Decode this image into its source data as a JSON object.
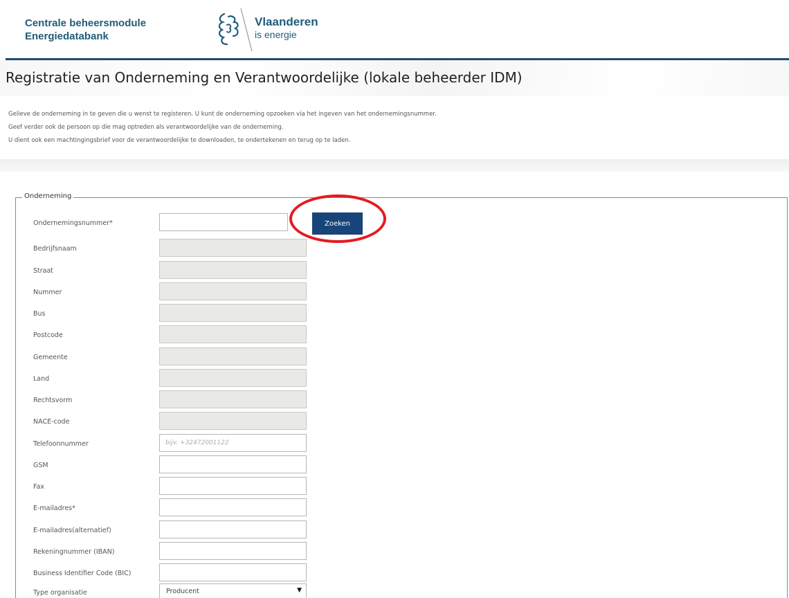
{
  "header": {
    "brand_line1": "Centrale beheersmodule",
    "brand_line2": "Energiedatabank",
    "logo_line1": "Vlaanderen",
    "logo_line2": "is energie",
    "accent_color": "#1f4b6e",
    "logo_icon": "flemish-lion-icon"
  },
  "page": {
    "title": "Registratie van Onderneming en Verantwoordelijke (lokale beheerder IDM)",
    "intro": [
      "Gelieve de onderneming in te geven die u wenst te registeren. U kunt de onderneming opzoeken via het ingeven van het ondernemingsnummer.",
      "Geef verder ook de persoon op die mag optreden als verantwoordelijke van de onderneming.",
      "U dient ook een machtingingsbrief voor de verantwoordelijke te downloaden, te ondertekenen en terug op te laden."
    ]
  },
  "form": {
    "legend": "Onderneming",
    "search_button": "Zoeken",
    "search_button_color": "#17457a",
    "annotation_color": "#e31b23",
    "fields": {
      "ondernemingsnummer": {
        "label": "Ondernemingsnummer*",
        "value": ""
      },
      "bedrijfsnaam": {
        "label": "Bedrijfsnaam",
        "value": ""
      },
      "straat": {
        "label": "Straat",
        "value": ""
      },
      "nummer": {
        "label": "Nummer",
        "value": ""
      },
      "bus": {
        "label": "Bus",
        "value": ""
      },
      "postcode": {
        "label": "Postcode",
        "value": ""
      },
      "gemeente": {
        "label": "Gemeente",
        "value": ""
      },
      "land": {
        "label": "Land",
        "value": ""
      },
      "rechtsvorm": {
        "label": "Rechtsvorm",
        "value": ""
      },
      "nace_code": {
        "label": "NACE-code",
        "value": ""
      },
      "telefoonnummer": {
        "label": "Telefoonnummer",
        "value": "",
        "placeholder": "bijv. +32472001122"
      },
      "gsm": {
        "label": "GSM",
        "value": ""
      },
      "fax": {
        "label": "Fax",
        "value": ""
      },
      "emailadres": {
        "label": "E-mailadres*",
        "value": ""
      },
      "emailadres_alternatief": {
        "label": "E-mailadres(alternatief)",
        "value": ""
      },
      "rekeningnummer": {
        "label": "Rekeningnummer (IBAN)",
        "value": ""
      },
      "bic": {
        "label": "Business Identifier Code (BIC)",
        "value": ""
      },
      "type_organisatie": {
        "label": "Type organisatie",
        "value": "Producent"
      }
    }
  }
}
